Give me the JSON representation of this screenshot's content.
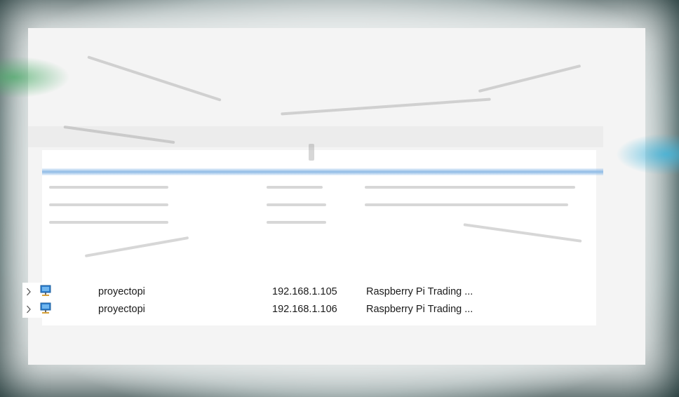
{
  "devices": [
    {
      "name": "proyectopi",
      "ip": "192.168.1.105",
      "manufacturer": "Raspberry Pi Trading ..."
    },
    {
      "name": "proyectopi",
      "ip": "192.168.1.106",
      "manufacturer": "Raspberry Pi Trading ..."
    }
  ],
  "colors": {
    "frame": "#1e3a3a",
    "selection": "#8fbbe6",
    "text": "#1a1a1a"
  },
  "icons": {
    "expand": "chevron-right-icon",
    "device": "network-computer-icon"
  }
}
